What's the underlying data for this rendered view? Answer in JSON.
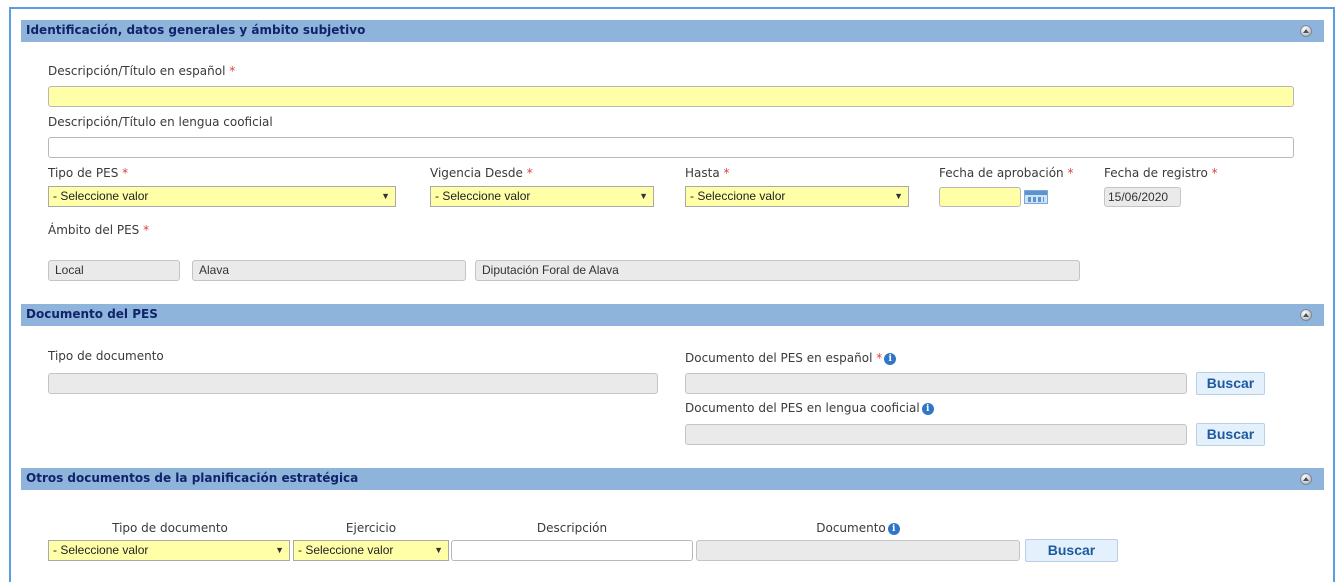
{
  "section1": {
    "title": "Identificación, datos generales y ámbito subjetivo",
    "desc_es_label": "Descripción/Título en español",
    "desc_es_value": "",
    "desc_cooficial_label": "Descripción/Título en lengua cooficial",
    "desc_cooficial_value": "",
    "tipo_pes_label": "Tipo de PES",
    "tipo_pes_value": "- Seleccione valor",
    "vigencia_label": "Vigencia Desde",
    "vigencia_value": "- Seleccione valor",
    "hasta_label": "Hasta",
    "hasta_value": "- Seleccione valor",
    "fecha_aprob_label": "Fecha de aprobación",
    "fecha_aprob_value": "",
    "fecha_reg_label": "Fecha de registro",
    "fecha_reg_value": "15/06/2020",
    "ambito_label": "Ámbito del PES",
    "ambito_values": [
      "Local",
      "Alava",
      "Diputación Foral de Alava"
    ],
    "required_mark": "*"
  },
  "section2": {
    "title": "Documento del PES",
    "tipo_doc_label": "Tipo de documento",
    "doc_es_label": "Documento del PES en español",
    "doc_cooficial_label": "Documento del PES en lengua cooficial",
    "buscar_label": "Buscar"
  },
  "section3": {
    "title": "Otros documentos de la planificación estratégica",
    "columns": [
      "Tipo de documento",
      "Ejercicio",
      "Descripción",
      "Documento"
    ],
    "tipo_value": "- Seleccione valor",
    "ejercicio_value": "- Seleccione valor",
    "buscar_label": "Buscar"
  },
  "icons": {
    "info": "i",
    "select_arrow": "▼"
  }
}
